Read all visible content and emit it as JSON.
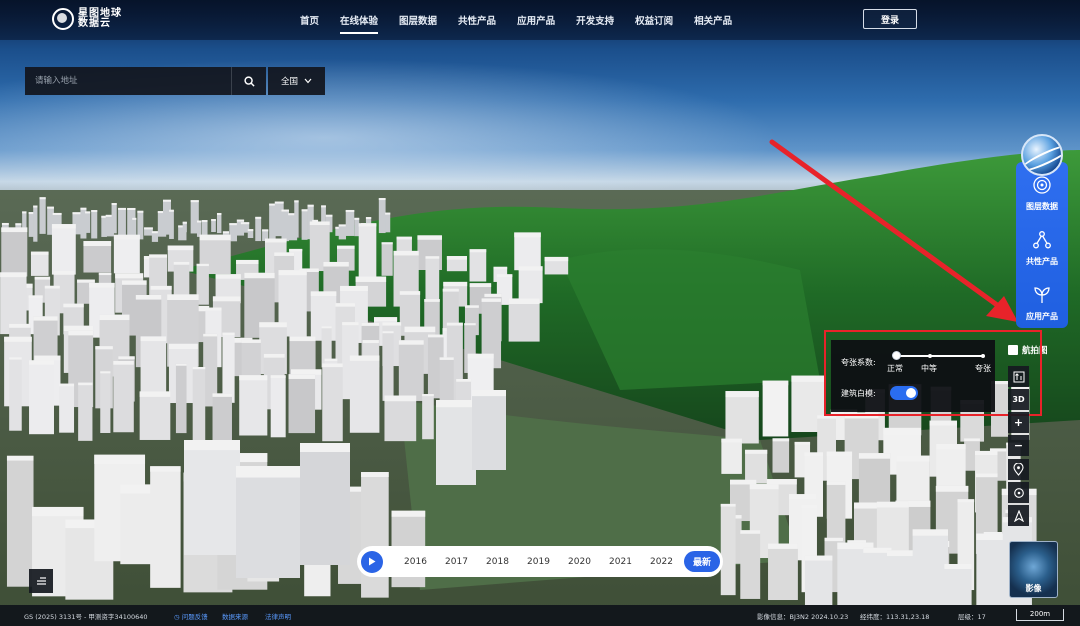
{
  "app": {
    "logo_line1": "星图地球",
    "logo_line2": "数据云"
  },
  "nav": {
    "items": [
      "首页",
      "在线体验",
      "图层数据",
      "共性产品",
      "应用产品",
      "开发支持",
      "权益订阅",
      "相关产品"
    ],
    "active": "在线体验",
    "login_label": "登录"
  },
  "search": {
    "placeholder": "请输入地址",
    "scope_label": "全国"
  },
  "side_menu": {
    "items": [
      {
        "label": "图层数据",
        "icon": "layers-circle-icon"
      },
      {
        "label": "共性产品",
        "icon": "share-nodes-icon"
      },
      {
        "label": "应用产品",
        "icon": "sprout-icon"
      }
    ]
  },
  "exaggeration": {
    "label": "夸张系数:",
    "levels": [
      "正常",
      "中等",
      "夸张"
    ],
    "selected": "正常",
    "white_model_label": "建筑白模:",
    "white_model_on": true
  },
  "map_tools": {
    "aerial_label": "航拍图",
    "mode_3d_label": "3D",
    "zoom_in": "+",
    "zoom_out": "−",
    "imagery_label": "影像"
  },
  "timeline": {
    "years": [
      "2016",
      "2017",
      "2018",
      "2019",
      "2020",
      "2021",
      "2022"
    ],
    "latest_label": "最新"
  },
  "status": {
    "license": "GS (2025) 3131号 - 甲测资字34100640",
    "feedback": "问题反馈",
    "data_source": "数据来源",
    "legal": "法律声明",
    "imagery_info": "影像信息：BJ3N2 2024.10.23",
    "longitude": "经纬度：113.31,23.18",
    "level": "层级：17",
    "scale": "200m"
  },
  "colors": {
    "accent": "#2a64e6",
    "highlight_box": "#e8232a",
    "panel_bg": "#0e1014"
  }
}
